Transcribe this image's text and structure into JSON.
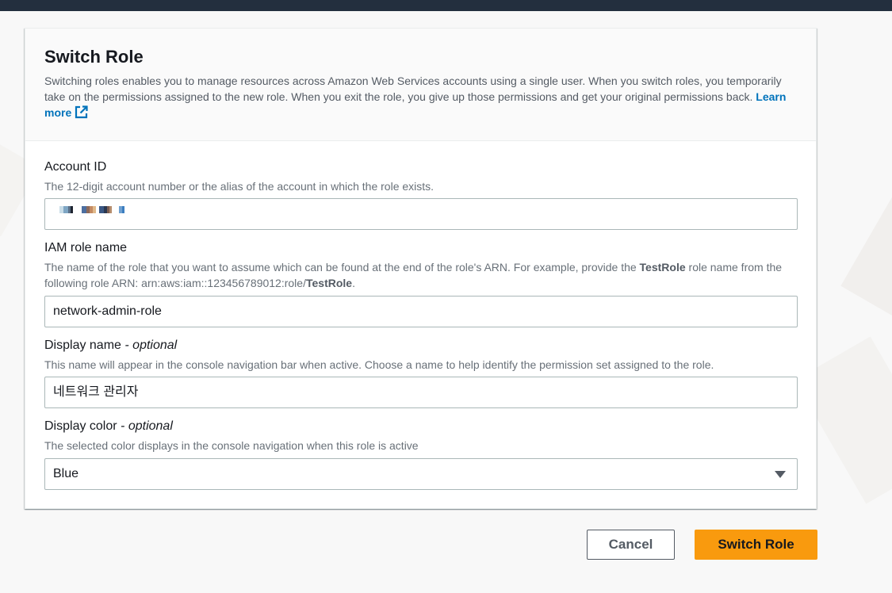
{
  "panel": {
    "title": "Switch Role",
    "description": "Switching roles enables you to manage resources across Amazon Web Services accounts using a single user. When you switch roles, you temporarily take on the permissions assigned to the new role. When you exit the role, you give up those permissions and get your original permissions back.",
    "learn_more_label": "Learn more"
  },
  "fields": {
    "account_id": {
      "label": "Account ID",
      "hint": "The 12-digit account number or the alias of the account in which the role exists.",
      "value": ""
    },
    "role_name": {
      "label": "IAM role name",
      "hint_part1": "The name of the role that you want to assume which can be found at the end of the role's ARN. For example, provide the ",
      "hint_bold1": "TestRole",
      "hint_part2": " role name from the following role ARN: arn:aws:iam::123456789012:role/",
      "hint_bold2": "TestRole",
      "hint_part3": ".",
      "value": "network-admin-role"
    },
    "display_name": {
      "label": "Display name",
      "optional": "- optional",
      "hint": "This name will appear in the console navigation bar when active. Choose a name to help identify the permission set assigned to the role.",
      "value": "네트워크 관리자"
    },
    "display_color": {
      "label": "Display color",
      "optional": "- optional",
      "hint": "The selected color displays in the console navigation when this role is active",
      "value": "Blue"
    }
  },
  "buttons": {
    "cancel": "Cancel",
    "switch_role": "Switch Role"
  },
  "colors": {
    "topbar": "#232f3e",
    "primary_button": "#f99a0e",
    "link": "#0073bb"
  },
  "icons": {
    "learn_more": "external-link-icon",
    "select": "caret-down-icon"
  }
}
